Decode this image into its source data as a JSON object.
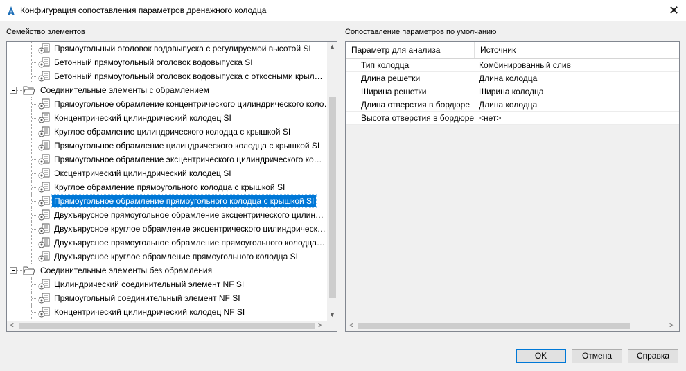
{
  "window": {
    "title": "Конфигурация сопоставления параметров дренажного колодца",
    "close_glyph": "✕"
  },
  "left_panel": {
    "label": "Семейство элементов",
    "tree": [
      {
        "level": 2,
        "label": "Прямоугольный оголовок водовыпуска с регулируемой высотой SI",
        "icon": "part-family-icon"
      },
      {
        "level": 2,
        "label": "Бетонный прямоугольный оголовок водовыпуска SI",
        "icon": "part-family-icon"
      },
      {
        "level": 2,
        "label": "Бетонный прямоугольный оголовок водовыпуска с откосными крыл…",
        "icon": "part-family-icon"
      },
      {
        "level": 1,
        "label": "Соединительные элементы с обрамлением",
        "icon": "open-folder-icon",
        "expanded": true
      },
      {
        "level": 2,
        "label": "Прямоугольное обрамление концентрического цилиндрического коло…",
        "icon": "part-family-icon"
      },
      {
        "level": 2,
        "label": "Концентрический цилиндрический колодец SI",
        "icon": "part-family-icon"
      },
      {
        "level": 2,
        "label": "Круглое обрамление цилиндрического колодца с крышкой SI",
        "icon": "part-family-icon"
      },
      {
        "level": 2,
        "label": "Прямоугольное обрамление цилиндрического колодца с крышкой SI",
        "icon": "part-family-icon"
      },
      {
        "level": 2,
        "label": "Прямоугольное обрамление эксцентрического цилиндрического ко…",
        "icon": "part-family-icon"
      },
      {
        "level": 2,
        "label": "Эксцентрический цилиндрический колодец SI",
        "icon": "part-family-icon"
      },
      {
        "level": 2,
        "label": "Круглое обрамление прямоугольного колодца с крышкой SI",
        "icon": "part-family-icon"
      },
      {
        "level": 2,
        "label": "Прямоугольное обрамление прямоугольного колодца с крышкой SI",
        "icon": "part-family-icon",
        "selected": true
      },
      {
        "level": 2,
        "label": "Двухъярусное прямоугольное обрамление эксцентрического цилин…",
        "icon": "part-family-icon"
      },
      {
        "level": 2,
        "label": "Двухъярусное круглое обрамление эксцентрического цилиндрическ…",
        "icon": "part-family-icon"
      },
      {
        "level": 2,
        "label": "Двухъярусное прямоугольное обрамление прямоугольного колодца…",
        "icon": "part-family-icon"
      },
      {
        "level": 2,
        "label": "Двухъярусное круглое обрамление прямоугольного колодца SI",
        "icon": "part-family-icon"
      },
      {
        "level": 1,
        "label": "Соединительные элементы без обрамления",
        "icon": "open-folder-icon",
        "expanded": true
      },
      {
        "level": 2,
        "label": "Цилиндрический соединительный элемент NF SI",
        "icon": "part-family-icon"
      },
      {
        "level": 2,
        "label": "Прямоугольный соединительный элемент NF SI",
        "icon": "part-family-icon"
      },
      {
        "level": 2,
        "label": "Концентрический цилиндрический колодец NF SI",
        "icon": "part-family-icon"
      }
    ]
  },
  "right_panel": {
    "label": "Сопоставление параметров по умолчанию",
    "columns": [
      "Параметр для анализа",
      "Источник"
    ],
    "rows": [
      {
        "param": "Тип колодца",
        "source": "Комбинированный слив"
      },
      {
        "param": "Длина решетки",
        "source": "Длина колодца"
      },
      {
        "param": "Ширина решетки",
        "source": "Ширина колодца"
      },
      {
        "param": "Длина отверстия в бордюре",
        "source": "Длина колодца"
      },
      {
        "param": "Высота отверстия в бордюре",
        "source": "<нет>"
      }
    ]
  },
  "buttons": {
    "ok": "OK",
    "cancel": "Отмена",
    "help": "Справка"
  },
  "colors": {
    "selection": "#0078d7",
    "app_icon": "#1d6fb8"
  }
}
